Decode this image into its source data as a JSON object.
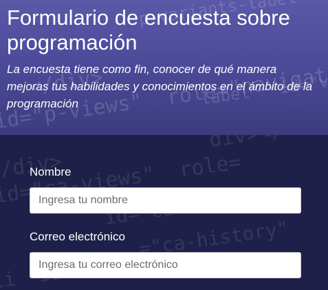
{
  "header": {
    "title": "Formulario de encuesta sobre programación",
    "description": "La encuesta tiene como fin, conocer de qué manera mejoras tus habilidades y conocimientos en el ámbito de la programación"
  },
  "form": {
    "name": {
      "label": "Nombre",
      "placeholder": "Ingresa tu nombre",
      "value": ""
    },
    "email": {
      "label": "Correo electrónico",
      "placeholder": "Ingresa tu correo electrónico",
      "value": ""
    }
  },
  "colors": {
    "header_top": "#5b58a8",
    "page_background": "#1f2049",
    "text": "#ffffff"
  }
}
